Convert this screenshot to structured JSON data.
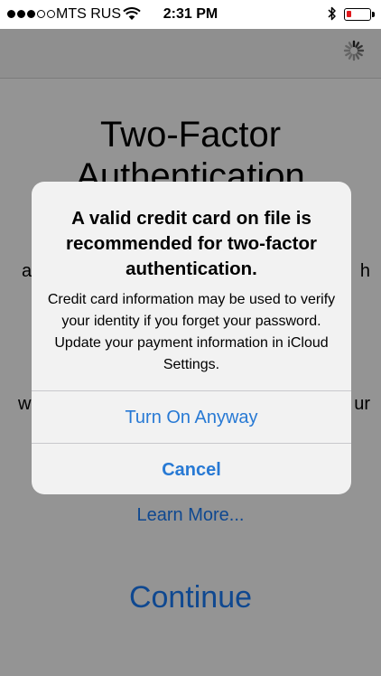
{
  "status_bar": {
    "carrier": "MTS RUS",
    "time": "2:31 PM",
    "signal_bars_filled": 3,
    "signal_bars_total": 5,
    "battery_level": 0.2,
    "battery_color": "#e0191d",
    "icons": [
      "signal-dots",
      "wifi-icon",
      "bluetooth-icon",
      "battery-icon"
    ]
  },
  "nav_bar": {
    "activity_indicator": "spinner-icon"
  },
  "page": {
    "title_line1": "Two-Factor",
    "title_line2": "Authentication",
    "body_line1": "a",
    "body_line2": "h",
    "body_line3": "w",
    "body_line4": "ur",
    "learn_more": "Learn More...",
    "continue": "Continue"
  },
  "alert": {
    "title": "A valid credit card on file is recommended for two-factor authentication.",
    "message": "Credit card information may be used to verify your identity if you forget your password. Update your payment information in iCloud Settings.",
    "buttons": [
      {
        "label": "Turn On Anyway",
        "style": "default"
      },
      {
        "label": "Cancel",
        "style": "bold"
      }
    ]
  },
  "colors": {
    "link_blue": "#1a7cf9",
    "alert_button_blue": "#2779d4",
    "alert_background": "#f2f2f2"
  }
}
